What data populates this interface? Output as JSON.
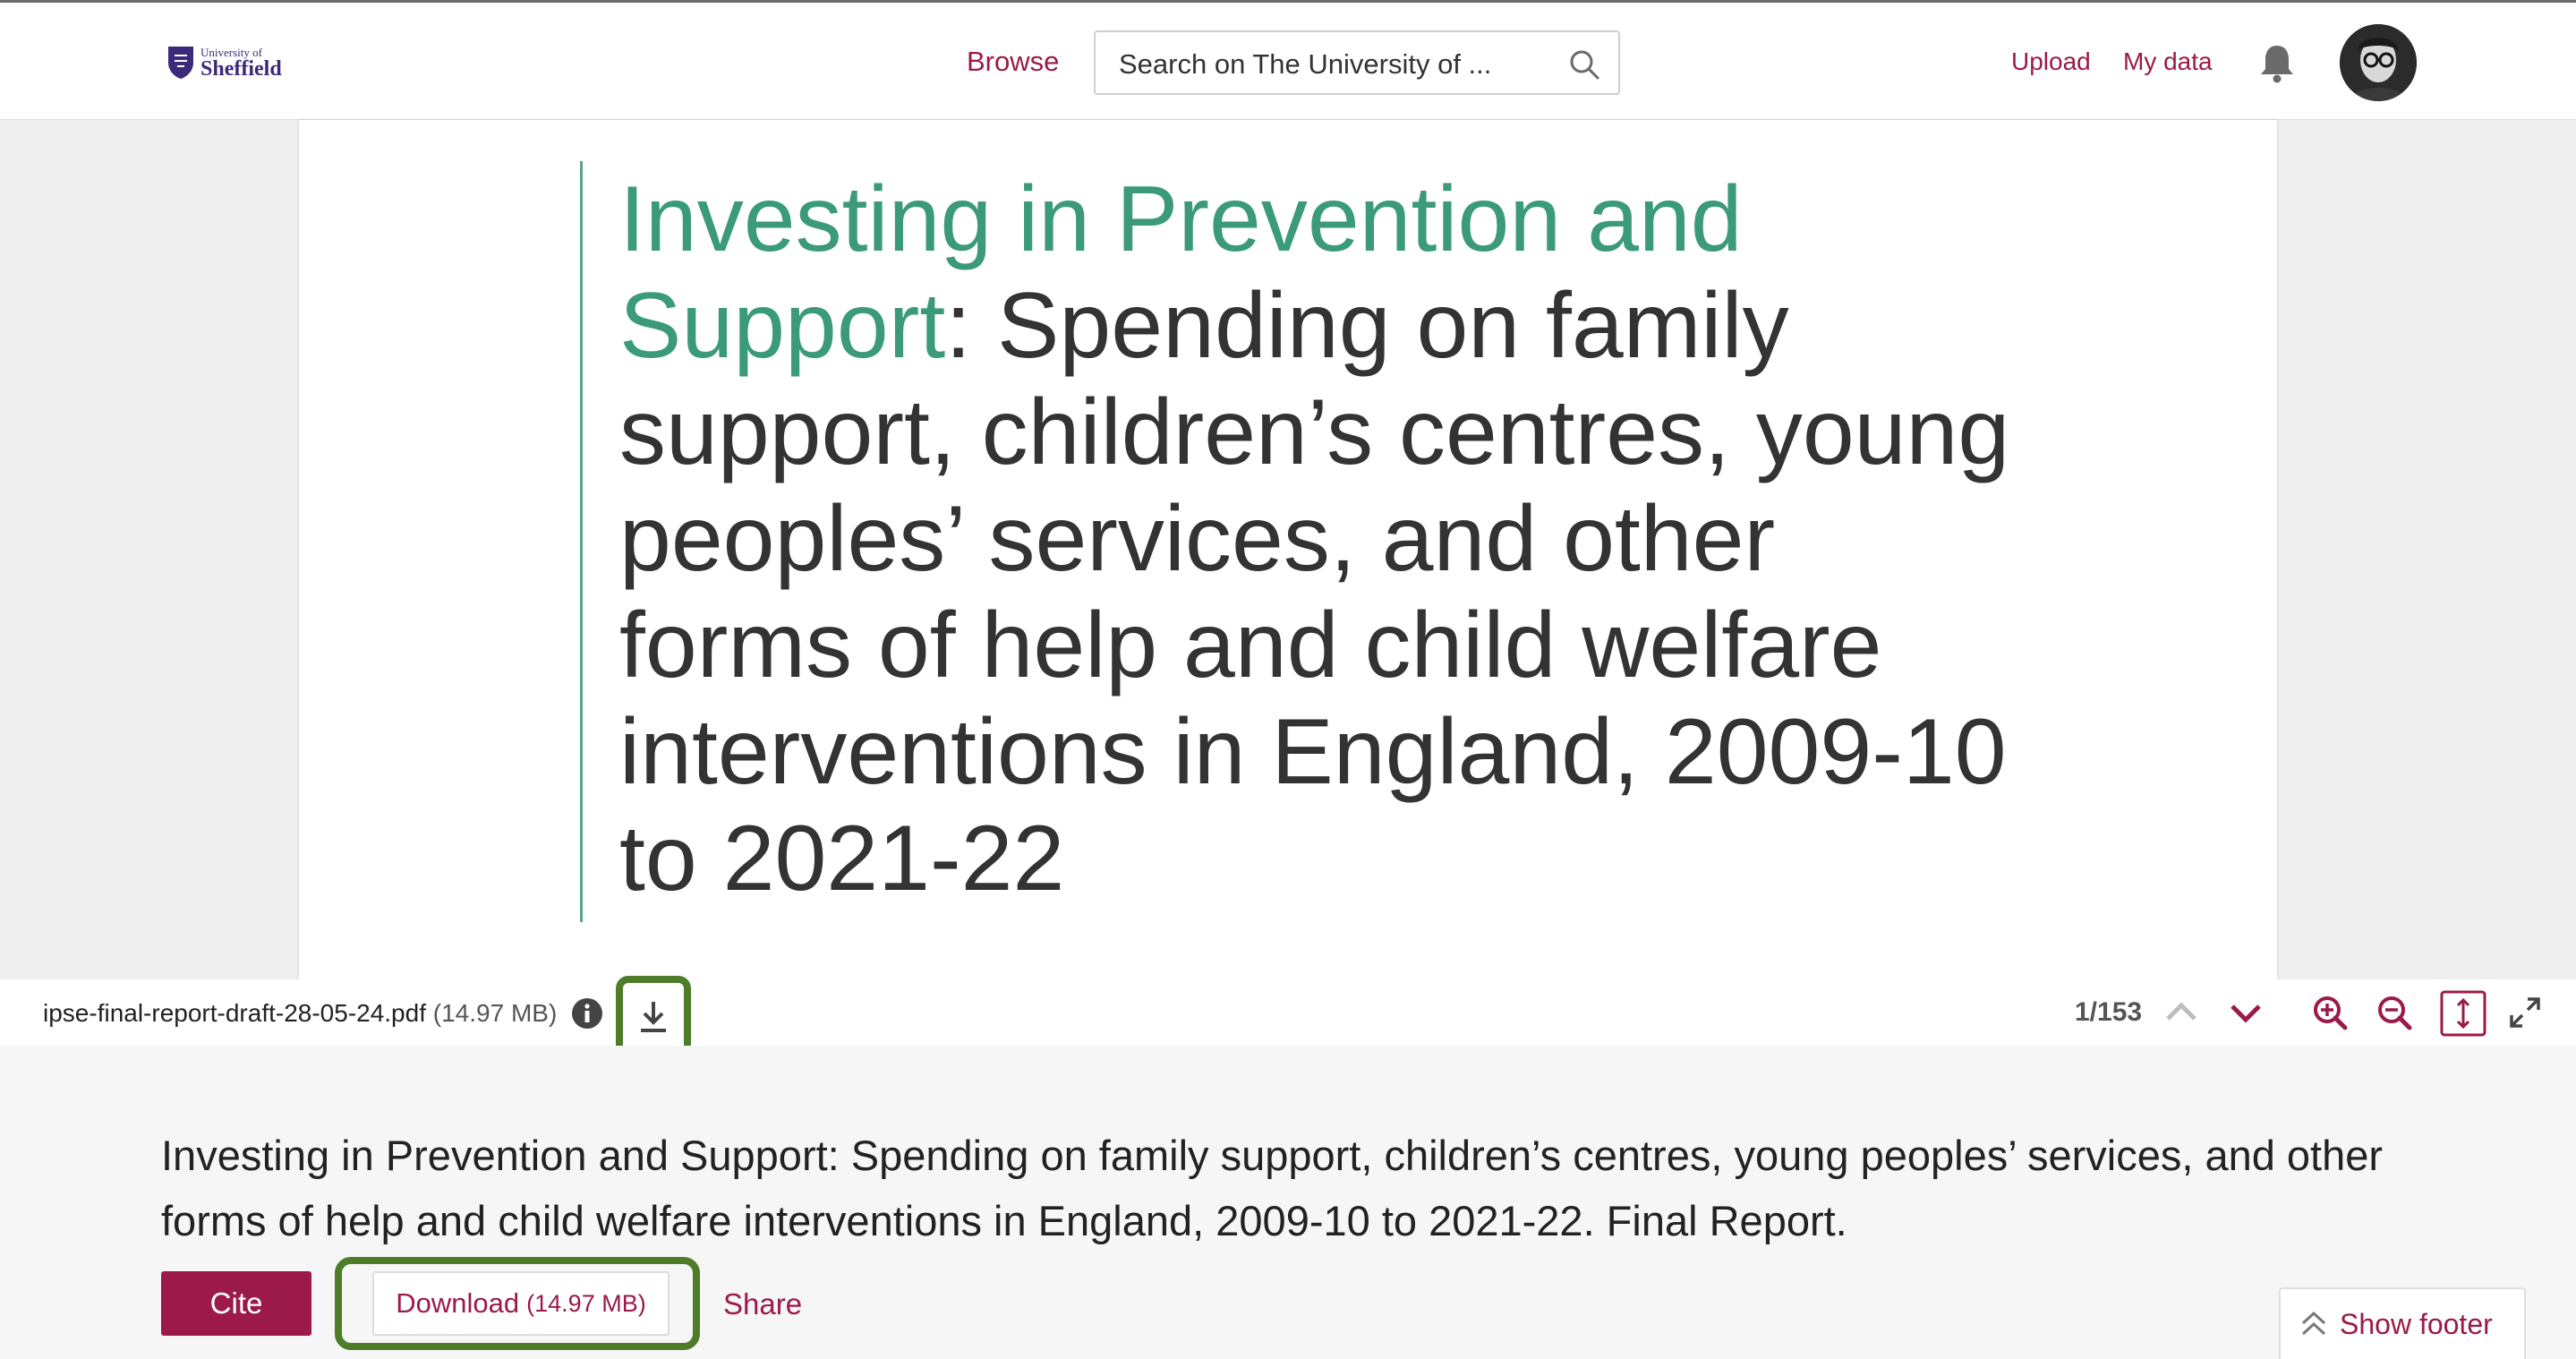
{
  "header": {
    "logo_line1": "University of",
    "logo_line2": "Sheffield",
    "browse_label": "Browse",
    "search_placeholder": "Search on The University of ...",
    "upload_label": "Upload",
    "mydata_label": "My data"
  },
  "viewer": {
    "page_title_accent": "Investing in Prevention and Support",
    "page_title_rest": ": Spending on family support, children’s centres, young peoples’ services, and other forms of help and child welfare interventions in England, 2009-10 to 2021-22",
    "file_name": "ipse-final-report-draft-28-05-24.pdf",
    "file_size": "(14.97 MB)",
    "page_indicator": "1/153"
  },
  "item": {
    "title": "Investing in Prevention and Support: Spending on family support, children’s centres, young peoples’ services, and other forms of help and child welfare interventions in England, 2009-10 to 2021-22. Final Report.",
    "cite_label": "Cite",
    "download_label": "Download",
    "download_size": "(14.97 MB)",
    "share_label": "Share",
    "show_footer_label": "Show footer"
  },
  "colors": {
    "brand": "#9b1a4a",
    "accent_green": "#3b9a7a",
    "highlight": "#4e7d2a"
  }
}
